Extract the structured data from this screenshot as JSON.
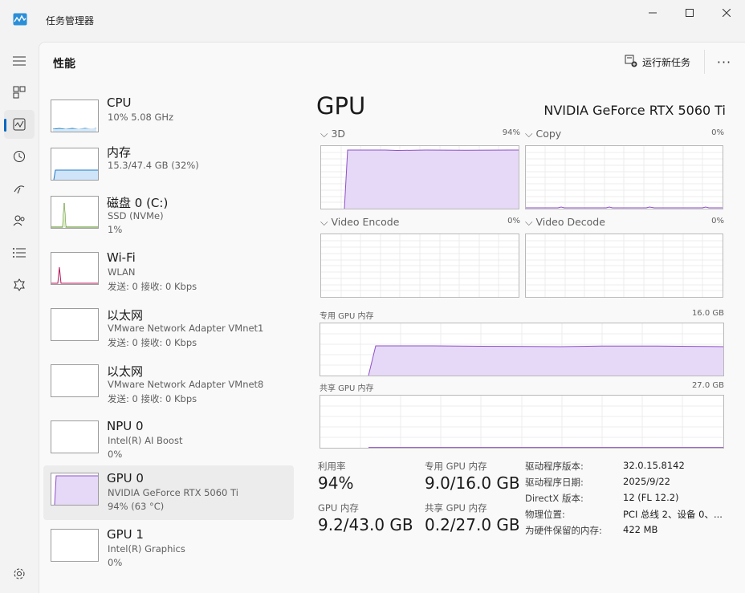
{
  "window": {
    "title": "任务管理器"
  },
  "header": {
    "page_title": "性能",
    "run_task_label": "运行新任务",
    "more_label": "···"
  },
  "devices": [
    {
      "name": "CPU",
      "line2": "10%  5.08 GHz",
      "line3": ""
    },
    {
      "name": "内存",
      "line2": "15.3/47.4 GB (32%)",
      "line3": ""
    },
    {
      "name": "磁盘 0 (C:)",
      "line2": "SSD (NVMe)",
      "line3": "1%"
    },
    {
      "name": "Wi-Fi",
      "line2": "WLAN",
      "line3": "发送: 0 接收: 0 Kbps"
    },
    {
      "name": "以太网",
      "line2": "VMware Network Adapter VMnet1",
      "line3": "发送: 0 接收: 0 Kbps"
    },
    {
      "name": "以太网",
      "line2": "VMware Network Adapter VMnet8",
      "line3": "发送: 0 接收: 0 Kbps"
    },
    {
      "name": "NPU 0",
      "line2": "Intel(R) AI Boost",
      "line3": "0%"
    },
    {
      "name": "GPU 0",
      "line2": "NVIDIA GeForce RTX 5060 Ti",
      "line3": "94% (63 °C)"
    },
    {
      "name": "GPU 1",
      "line2": "Intel(R) Graphics",
      "line3": "0%"
    }
  ],
  "detail": {
    "title": "GPU",
    "model": "NVIDIA GeForce RTX 5060 Ti",
    "engines": [
      {
        "label": "3D",
        "pct": "94%"
      },
      {
        "label": "Copy",
        "pct": "0%"
      },
      {
        "label": "Video Encode",
        "pct": "0%"
      },
      {
        "label": "Video Decode",
        "pct": "0%"
      }
    ],
    "dedicated_mem": {
      "label": "专用 GPU 内存",
      "max": "16.0 GB"
    },
    "shared_mem": {
      "label": "共享 GPU 内存",
      "max": "27.0 GB"
    },
    "stats": {
      "utilization_label": "利用率",
      "utilization": "94%",
      "dedicated_label": "专用 GPU 内存",
      "dedicated": "9.0/16.0 GB",
      "gpu_mem_label": "GPU 内存",
      "gpu_mem": "9.2/43.0 GB",
      "shared_label": "共享 GPU 内存",
      "shared": "0.2/27.0 GB"
    },
    "info": [
      {
        "k": "驱动程序版本:",
        "v": "32.0.15.8142"
      },
      {
        "k": "驱动程序日期:",
        "v": "2025/9/22"
      },
      {
        "k": "DirectX 版本:",
        "v": "12 (FL 12.2)"
      },
      {
        "k": "物理位置:",
        "v": "PCI 总线 2、设备 0、..."
      },
      {
        "k": "为硬件保留的内存:",
        "v": "422 MB"
      }
    ]
  },
  "colors": {
    "gpu_purple": "#8e4fc9",
    "gpu_fill": "#e6d9f7",
    "accent": "#0067c0"
  }
}
